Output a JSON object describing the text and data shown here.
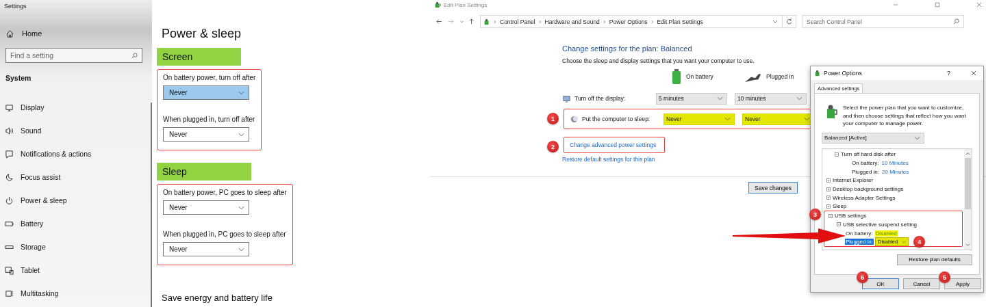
{
  "settings": {
    "title": "Settings",
    "home": "Home",
    "search": {
      "placeholder": "Find a setting"
    },
    "section": "System",
    "nav": [
      {
        "label": "Display"
      },
      {
        "label": "Sound"
      },
      {
        "label": "Notifications & actions"
      },
      {
        "label": "Focus assist"
      },
      {
        "label": "Power & sleep"
      },
      {
        "label": "Battery"
      },
      {
        "label": "Storage"
      },
      {
        "label": "Tablet"
      },
      {
        "label": "Multitasking"
      }
    ]
  },
  "power_sleep": {
    "title": "Power & sleep",
    "groups": [
      {
        "heading": "Screen",
        "highlighted": true,
        "outlined": true,
        "fields": [
          {
            "label": "On battery power, turn off after",
            "value": "Never",
            "selected": true
          },
          {
            "label": "When plugged in, turn off after",
            "value": "Never",
            "selected": false
          }
        ]
      },
      {
        "heading": "Sleep",
        "highlighted": true,
        "outlined": true,
        "fields": [
          {
            "label": "On battery power, PC goes to sleep after",
            "value": "Never",
            "selected": false
          },
          {
            "label": "When plugged in, PC goes to sleep after",
            "value": "Never",
            "selected": false
          }
        ]
      }
    ],
    "footer_heading": "Save energy and battery life"
  },
  "edit_plan": {
    "title": "Edit Plan Settings",
    "breadcrumb": [
      "Control Panel",
      "Hardware and Sound",
      "Power Options",
      "Edit Plan Settings"
    ],
    "search": {
      "placeholder": "Search Control Panel"
    },
    "heading": "Change settings for the plan: Balanced",
    "description": "Choose the sleep and display settings that you want your computer to use.",
    "columns": [
      "On battery",
      "Plugged in"
    ],
    "rows": [
      {
        "label": "Turn off the display:",
        "values": [
          "5 minutes",
          "10 minutes"
        ],
        "highlighted": false
      },
      {
        "label": "Put the computer to sleep:",
        "values": [
          "Never",
          "Never"
        ],
        "highlighted": true,
        "annotation": "1"
      }
    ],
    "links": [
      {
        "label": "Change advanced power settings",
        "annotation": "2"
      },
      {
        "label": "Restore default settings for this plan"
      }
    ],
    "buttons": [
      "Save changes"
    ]
  },
  "power_options": {
    "title": "Power Options",
    "help": "?",
    "tab": "Advanced settings",
    "description": "Select the power plan that you want to customize, and then choose settings that reflect how you want your computer to manage power.",
    "plan": "Balanced [Active]",
    "tree": [
      {
        "label": "Turn off hard disk after",
        "expanded": true,
        "children": [
          {
            "kind": "value",
            "label": "On battery:",
            "value": "10 Minutes",
            "highlighted": false
          },
          {
            "kind": "value",
            "label": "Plugged in:",
            "value": "20 Minutes",
            "highlighted": false
          }
        ]
      },
      {
        "label": "Internet Explorer",
        "expanded": false
      },
      {
        "label": "Desktop background settings",
        "expanded": false
      },
      {
        "label": "Wireless Adapter Settings",
        "expanded": false
      },
      {
        "label": "Sleep",
        "expanded": false
      },
      {
        "label": "USB settings",
        "expanded": true,
        "annotation": "3",
        "children": [
          {
            "label": "USB selective suspend setting",
            "expanded": true,
            "children": [
              {
                "kind": "value",
                "label": "On battery:",
                "value": "Disabled",
                "highlighted": true
              },
              {
                "kind": "dropdown",
                "label": "Plugged in:",
                "value": "Disabled",
                "highlighted": true,
                "selected": true,
                "annotation": "4"
              }
            ]
          }
        ]
      }
    ],
    "restore": "Restore plan defaults",
    "buttons": [
      {
        "label": "OK",
        "default": true,
        "annotation": "6"
      },
      {
        "label": "Cancel",
        "default": false
      },
      {
        "label": "Apply",
        "default": false,
        "annotation": "5"
      }
    ]
  }
}
